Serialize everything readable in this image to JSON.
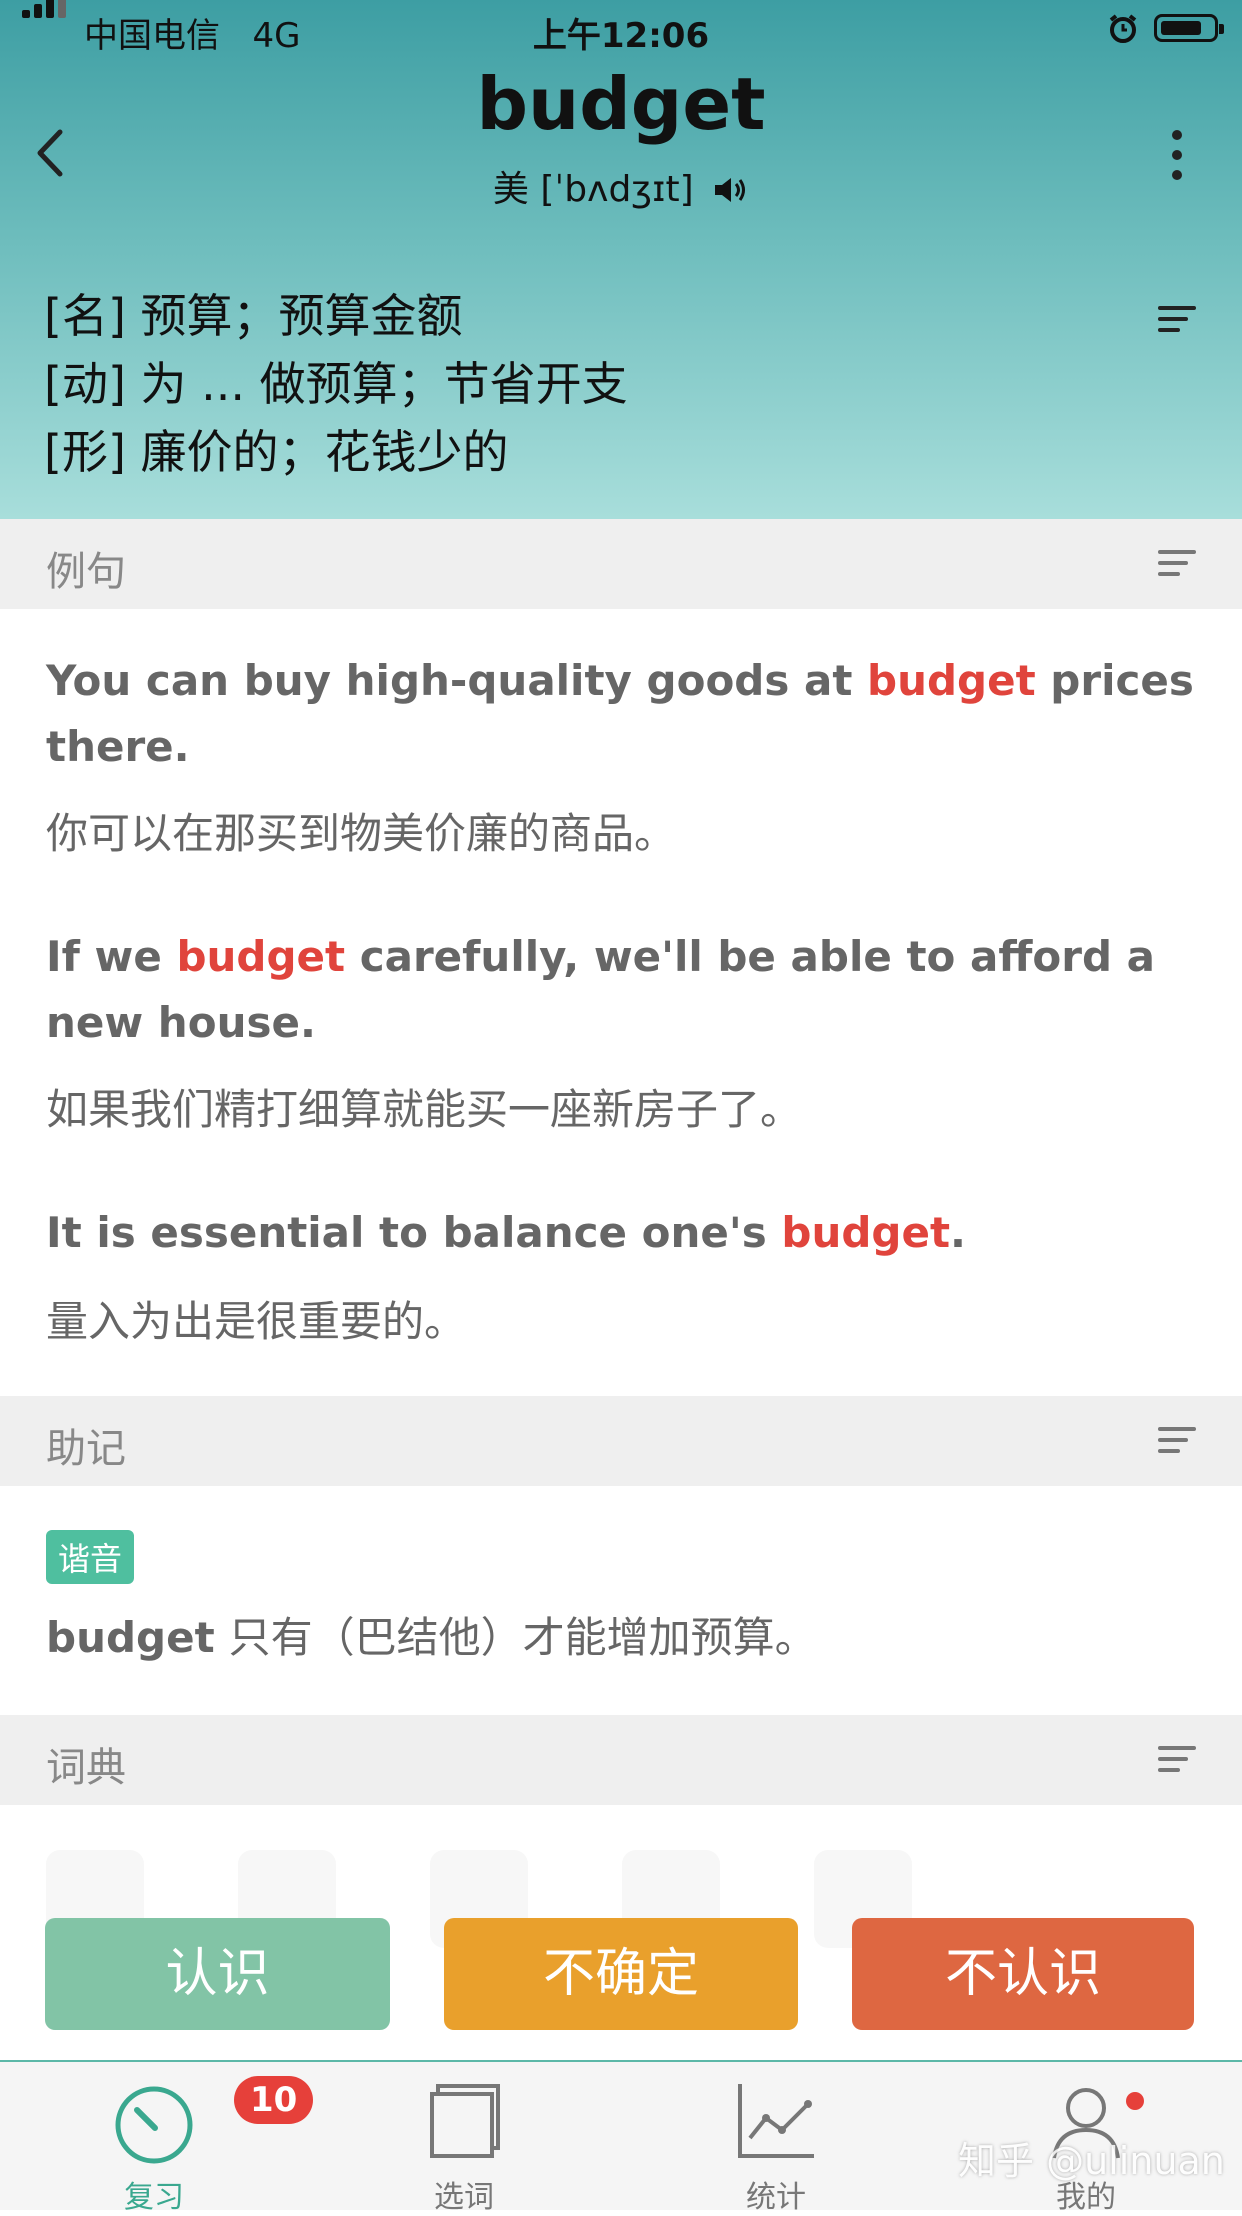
{
  "status": {
    "carrier": "中国电信",
    "network": "4G",
    "time": "上午12:06"
  },
  "word": {
    "text": "budget",
    "phonetic": "美 [ˈbʌdʒɪt]"
  },
  "definitions": [
    "[名] 预算；预算金额",
    "[动] 为 ... 做预算；节省开支",
    "[形] 廉价的；花钱少的"
  ],
  "sections": {
    "examples": "例句",
    "mnemonic": "助记",
    "dictionary": "词典"
  },
  "examples": [
    {
      "en_before": "You can buy high-quality goods at ",
      "en_highlight": "budget",
      "en_after": " prices there.",
      "cn": "你可以在那买到物美价廉的商品。"
    },
    {
      "en_before": "If we ",
      "en_highlight": "budget",
      "en_after": " carefully, we'll be able to afford a new house.",
      "cn": "如果我们精打细算就能买一座新房子了。"
    },
    {
      "en_before": "It is essential to balance one's ",
      "en_highlight": "budget",
      "en_after": ".",
      "cn": "量入为出是很重要的。"
    }
  ],
  "mnemonic": {
    "tag": "谐音",
    "word": "budget",
    "text": "只有（巴结他）才能增加预算。"
  },
  "actions": {
    "know": "认识",
    "unsure": "不确定",
    "dont_know": "不认识"
  },
  "colors": {
    "know": "#82c4a6",
    "unsure": "#e9a02c",
    "dont_know": "#de6741",
    "highlight": "#e0443c"
  },
  "tabs": [
    {
      "label": "复习",
      "icon": "speedometer-icon",
      "badge": "10"
    },
    {
      "label": "选词",
      "icon": "book-icon"
    },
    {
      "label": "统计",
      "icon": "chart-icon"
    },
    {
      "label": "我的",
      "icon": "person-icon"
    }
  ],
  "watermark": "知乎 @ulinuan"
}
